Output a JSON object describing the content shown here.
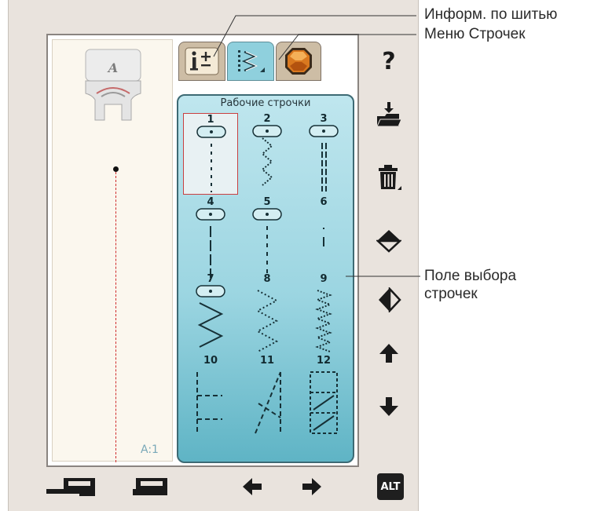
{
  "preview": {
    "foot_letter": "A",
    "stitch_code": "A:1"
  },
  "tabs": [
    {
      "name": "sewing-info-tab",
      "icon": "info-plus-icon",
      "active": false
    },
    {
      "name": "stitch-menu-tab",
      "icon": "stitch-menu-icon",
      "active": true
    },
    {
      "name": "jewel-tab",
      "icon": "jewel-icon",
      "active": false
    }
  ],
  "stitch_panel": {
    "title": "Рабочие строчки",
    "selected": "1",
    "stitches": [
      {
        "num": "1",
        "type": "straight-center"
      },
      {
        "num": "2",
        "type": "triple-zigzag"
      },
      {
        "num": "3",
        "type": "triple-straight"
      },
      {
        "num": "4",
        "type": "straight-long"
      },
      {
        "num": "5",
        "type": "straight-dashed"
      },
      {
        "num": "6",
        "type": "tack"
      },
      {
        "num": "7",
        "type": "zigzag-wide"
      },
      {
        "num": "8",
        "type": "zigzag-dotted"
      },
      {
        "num": "9",
        "type": "zigzag-small"
      },
      {
        "num": "10",
        "type": "blind-hem"
      },
      {
        "num": "11",
        "type": "overcast-slant"
      },
      {
        "num": "12",
        "type": "box-overlock"
      }
    ]
  },
  "side_buttons": [
    {
      "name": "help-button",
      "icon": "question-icon",
      "label": "?"
    },
    {
      "name": "open-folder-button",
      "icon": "folder-download-icon"
    },
    {
      "name": "delete-button",
      "icon": "trash-icon"
    },
    {
      "name": "mirror-vertical-button",
      "icon": "mirror-vertical-icon"
    },
    {
      "name": "mirror-horizontal-button",
      "icon": "mirror-horizontal-icon"
    },
    {
      "name": "scroll-up-button",
      "icon": "arrow-up-icon"
    },
    {
      "name": "scroll-down-button",
      "icon": "arrow-down-icon"
    }
  ],
  "bottom_buttons": {
    "alt_label": "ALT"
  },
  "callouts": {
    "sewing_info": "Информ. по шитью",
    "stitch_menu": "Меню Строчек",
    "stitch_select_line1": "Поле выбора",
    "stitch_select_line2": "строчек"
  },
  "colors": {
    "panel_accent": "#8fd0dd",
    "selected_border": "#c94040",
    "thread": "#cf2a2a"
  }
}
